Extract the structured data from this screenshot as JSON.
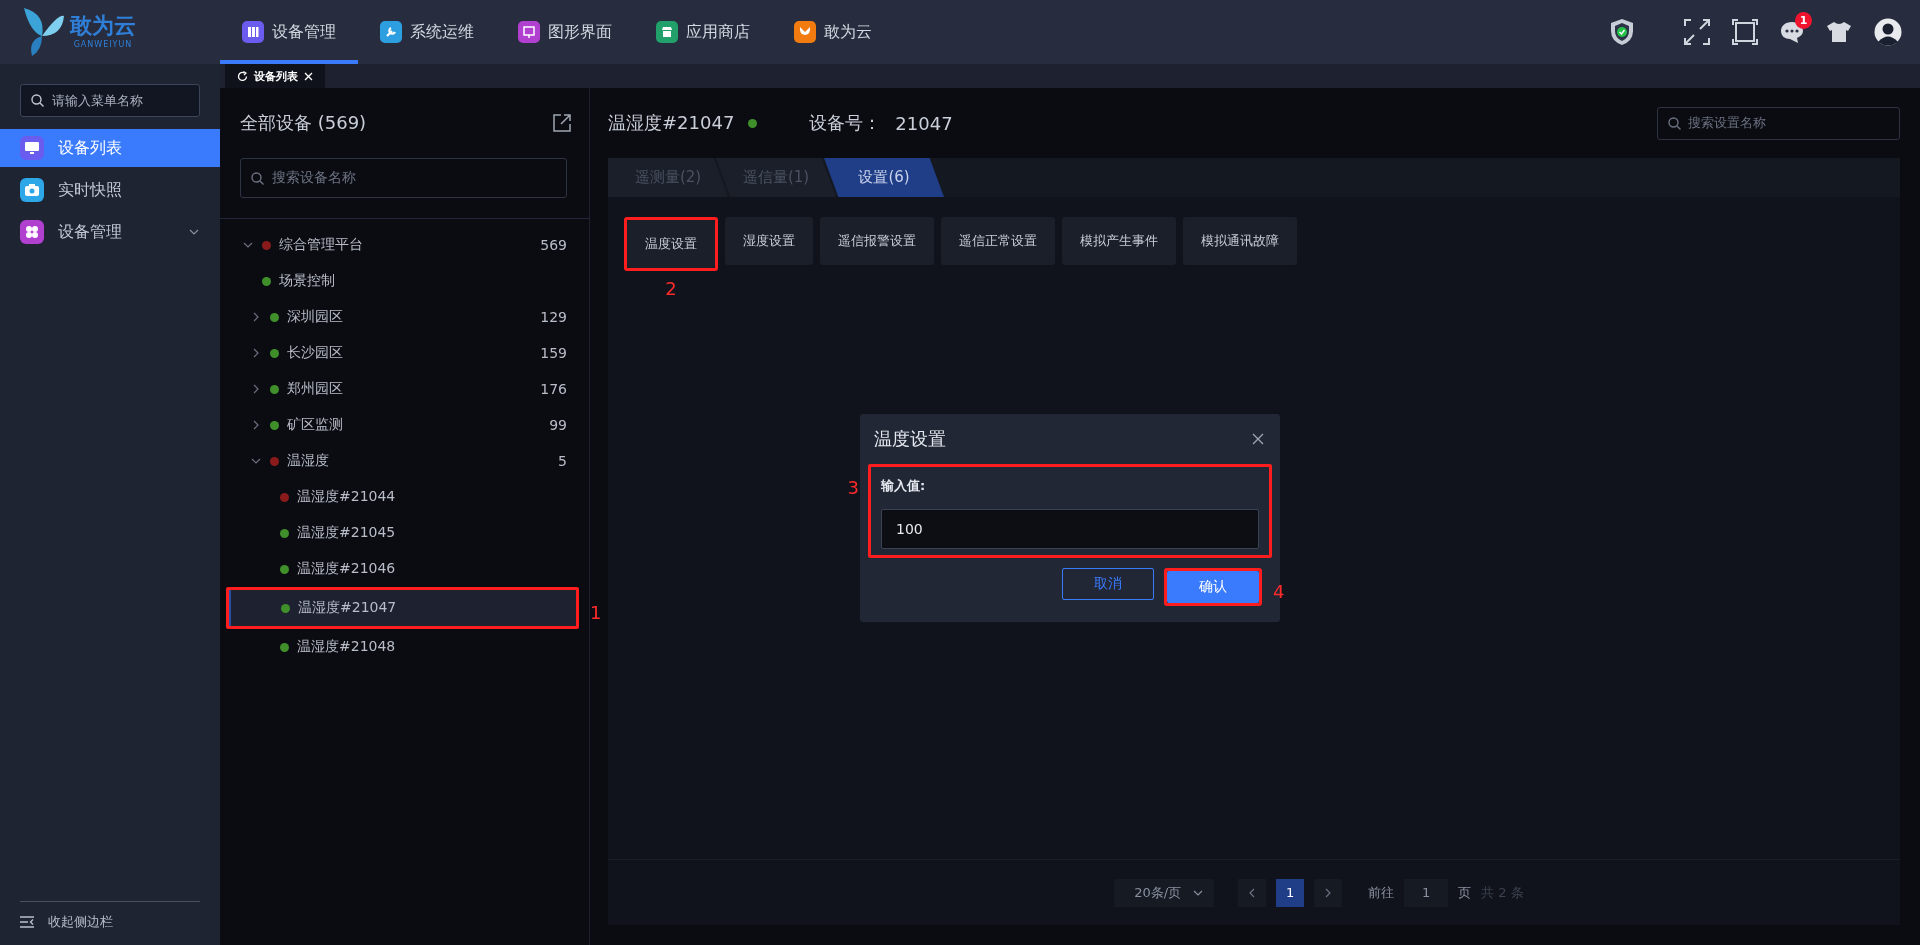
{
  "logo": {
    "name": "敢为云",
    "subtitle": "GANWEIYUN"
  },
  "nav": [
    {
      "label": "设备管理",
      "selected": true
    },
    {
      "label": "系统运维",
      "selected": false
    },
    {
      "label": "图形界面",
      "selected": false
    },
    {
      "label": "应用商店",
      "selected": false
    },
    {
      "label": "敢为云",
      "selected": false
    }
  ],
  "toolbar": {
    "notification_count": "1"
  },
  "page_tabs": [
    {
      "label": "设备列表",
      "selected": true
    }
  ],
  "sidebar": {
    "search": {
      "placeholder": "请输入菜单名称"
    },
    "items": [
      {
        "label": "设备列表",
        "selected": true
      },
      {
        "label": "实时快照",
        "selected": false
      },
      {
        "label": "设备管理",
        "selected": false,
        "expanded": false
      }
    ],
    "collapse_label": "收起侧边栏"
  },
  "device_tree": {
    "title": "全部设备 (569)",
    "search": {
      "placeholder": "搜索设备名称"
    },
    "nodes": [
      {
        "label": "综合管理平台",
        "count": "569",
        "color": "#8b1a1a",
        "expanded": true,
        "selected": false,
        "children": [
          {
            "label": "场景控制",
            "color": "#3f8f2a",
            "selected": false
          },
          {
            "label": "深圳园区",
            "count": "129",
            "color": "#3f8f2a",
            "expanded": false,
            "selected": false
          },
          {
            "label": "长沙园区",
            "count": "159",
            "color": "#3f8f2a",
            "expanded": false,
            "selected": false
          },
          {
            "label": "郑州园区",
            "count": "176",
            "color": "#3f8f2a",
            "expanded": false,
            "selected": false
          },
          {
            "label": "矿区监测",
            "count": "99",
            "color": "#3f8f2a",
            "expanded": false,
            "selected": false
          },
          {
            "label": "温湿度",
            "count": "5",
            "color": "#8b1a1a",
            "expanded": true,
            "selected": false,
            "children": [
              {
                "label": "温湿度#21044",
                "color": "#8b1a1a",
                "selected": false
              },
              {
                "label": "温湿度#21045",
                "color": "#3f8f2a",
                "selected": false
              },
              {
                "label": "温湿度#21046",
                "color": "#3f8f2a",
                "selected": false
              },
              {
                "label": "温湿度#21047",
                "color": "#3f8f2a",
                "selected": true,
                "annotation": "1"
              },
              {
                "label": "温湿度#21048",
                "color": "#3f8f2a",
                "selected": false
              }
            ]
          }
        ]
      }
    ]
  },
  "detail": {
    "device_name": "温湿度#21047",
    "color": "#3f8f2a",
    "device_number_label": "设备号：",
    "device_number": "21047",
    "search": {
      "placeholder": "搜索设置名称"
    },
    "tabs": [
      {
        "label": "遥测量(2)",
        "selected": false
      },
      {
        "label": "遥信量(1)",
        "selected": false
      },
      {
        "label": "设置(6)",
        "selected": true
      }
    ],
    "actions": [
      {
        "label": "温度设置",
        "annotation": "2"
      },
      {
        "label": "湿度设置"
      },
      {
        "label": "遥信报警设置"
      },
      {
        "label": "遥信正常设置"
      },
      {
        "label": "模拟产生事件"
      },
      {
        "label": "模拟通讯故障"
      }
    ],
    "pagination": {
      "page_size": "20条/页",
      "pages": [
        {
          "label": "1",
          "selected": true
        }
      ],
      "goto_label": "前往",
      "goto_value": "1",
      "page_unit": "页",
      "total": "共 2 条"
    }
  },
  "dialog": {
    "title": "温度设置",
    "field_label": "输入值:",
    "value": "100",
    "annotation": "3",
    "buttons": [
      {
        "label": "取消",
        "kind": "secondary"
      },
      {
        "label": "确认",
        "kind": "primary",
        "annotation": "4"
      }
    ]
  }
}
